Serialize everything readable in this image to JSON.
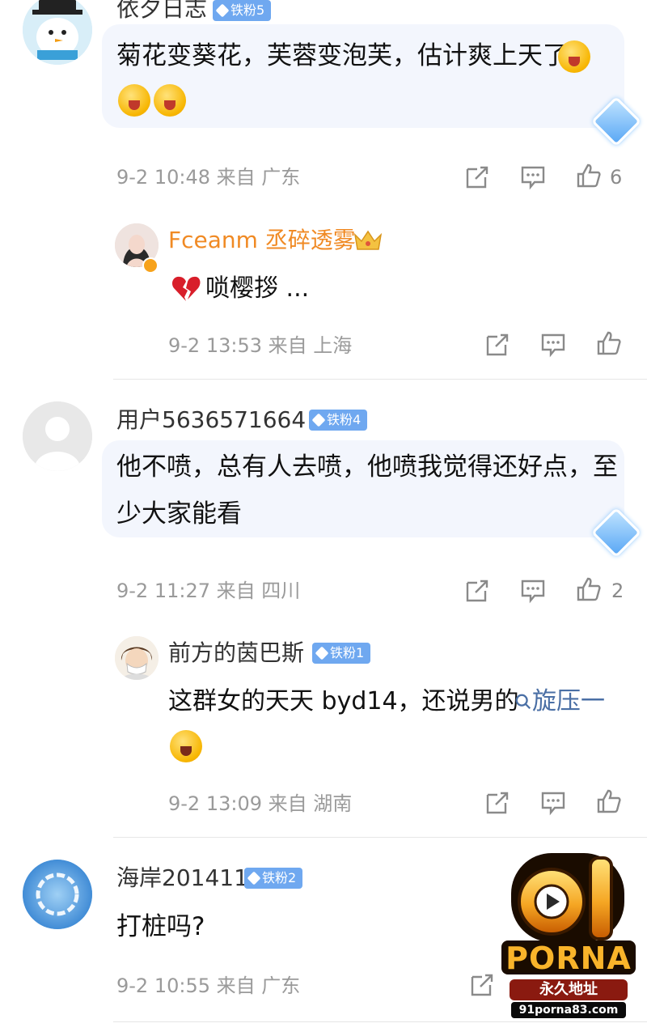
{
  "comments": [
    {
      "user": "依夕日志",
      "badge": "铁粉5",
      "text_line1": "菊花变葵花，芙蓉变泡芙，估计爽上天了",
      "meta": "9-2 10:48 来自 广东",
      "likes": "6",
      "reply": {
        "user": "Fceanm 丞碎透雾",
        "text": "唢樱拶 ...",
        "meta": "9-2 13:53 来自 上海"
      }
    },
    {
      "user": "用户5636571664",
      "badge": "铁粉4",
      "text_line1": "他不喷，总有人去喷，他喷我觉得还好点，至",
      "text_line2": "少大家能看",
      "meta": "9-2 11:27 来自 四川",
      "likes": "2",
      "reply": {
        "user": "前方的茵巴斯",
        "badge": "铁粉1",
        "text_main": "这群女的天天 byd14，还说男的",
        "search_link": "旋压一",
        "meta": "9-2 13:09 来自 湖南"
      }
    },
    {
      "user": "海岸201411",
      "badge": "铁粉2",
      "text_line1": "打桩吗?",
      "meta": "9-2 10:55 来自 广东"
    }
  ],
  "watermark": {
    "number": "91",
    "brand": "PORNA",
    "tagline": "永久地址",
    "url": "91porna83.com"
  },
  "icons": [
    "share-icon",
    "comment-icon",
    "like-icon",
    "search-icon",
    "crown-icon",
    "broken-heart-icon"
  ],
  "colors": {
    "badge": "#6fa8f0",
    "bubble": "#f3f6fd",
    "vip_name": "#f08a24",
    "meta": "#9a9a9a",
    "link": "#4a6fa5"
  }
}
